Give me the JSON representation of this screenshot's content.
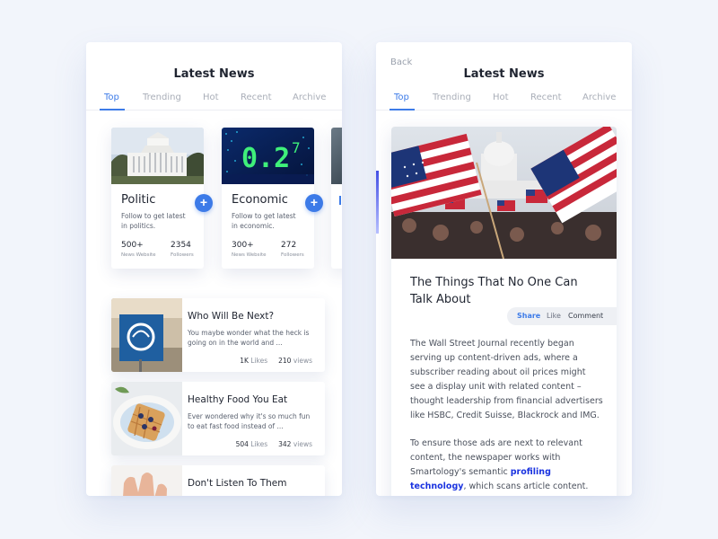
{
  "left_screen": {
    "title": "Latest News",
    "tabs": [
      "Top",
      "Trending",
      "Hot",
      "Recent",
      "Archive"
    ],
    "active_tab": "Top",
    "categories": [
      {
        "title": "Politic",
        "description": "Follow to get latest in politics.",
        "stats": [
          {
            "value": "500+",
            "label": "News Website"
          },
          {
            "value": "2354",
            "label": "Followers"
          }
        ]
      },
      {
        "title": "Economic",
        "description": "Follow to get latest in economic.",
        "stats": [
          {
            "value": "300+",
            "label": "News Website"
          },
          {
            "value": "272",
            "label": "Followers"
          }
        ]
      }
    ],
    "news": [
      {
        "title": "Who Will Be Next?",
        "description": "You maybe wonder what the heck is going on in the world and ...",
        "likes": "1K",
        "likes_label": "Likes",
        "views": "210",
        "views_label": "views"
      },
      {
        "title": "Healthy Food You Eat",
        "description": "Ever wondered why it's so much fun to eat fast food instead of ...",
        "likes": "504",
        "likes_label": "Likes",
        "views": "342",
        "views_label": "views"
      },
      {
        "title": "Don't Listen To Them"
      }
    ]
  },
  "right_screen": {
    "back_label": "Back",
    "title": "Latest News",
    "tabs": [
      "Top",
      "Trending",
      "Hot",
      "Recent",
      "Archive"
    ],
    "active_tab": "Top",
    "article": {
      "title": "The Things That No One Can Talk About",
      "actions": {
        "share": "Share",
        "like": "Like",
        "comment": "Comment"
      },
      "paragraph1": "The Wall Street Journal recently began serving up content-driven ads, where a subscriber reading about oil prices might see a display unit with related content – thought leadership from financial advertisers like HSBC, Credit Suisse, Blackrock and IMG.",
      "paragraph2_before": "To ensure those ads are next to relevant content, the newspaper works with Smartology's semantic ",
      "paragraph2_link": "profiling technology",
      "paragraph2_after": ", which scans article content."
    }
  },
  "colors": {
    "accent": "#3d7be8",
    "link": "#1a33e0",
    "background": "#f2f5fb"
  }
}
